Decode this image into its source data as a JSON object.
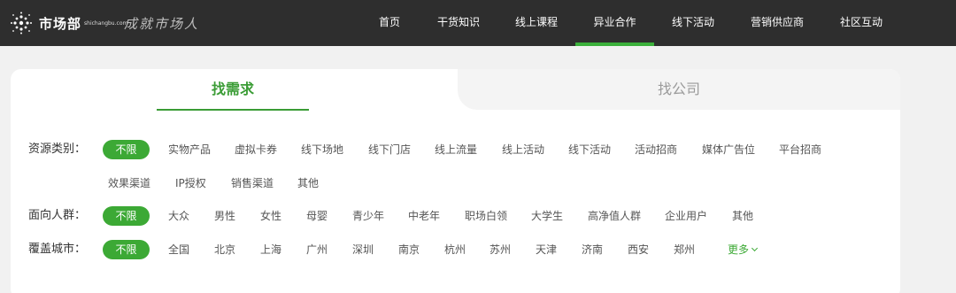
{
  "nav": {
    "logo_text": "市场部",
    "logo_sub": "shichangbu.com",
    "slogan": "成就市场人",
    "items": [
      "首页",
      "干货知识",
      "线上课程",
      "异业合作",
      "线下活动",
      "营销供应商",
      "社区互动"
    ],
    "active_index": 3
  },
  "tabs": {
    "left": "找需求",
    "right": "找公司"
  },
  "filters": {
    "resource": {
      "label": "资源类别：",
      "selected": "不限",
      "row1": [
        "实物产品",
        "虚拟卡券",
        "线下场地",
        "线下门店",
        "线上流量",
        "线上活动",
        "线下活动",
        "活动招商",
        "媒体广告位",
        "平台招商"
      ],
      "row2": [
        "效果渠道",
        "IP授权",
        "销售渠道",
        "其他"
      ]
    },
    "audience": {
      "label": "面向人群：",
      "selected": "不限",
      "options": [
        "大众",
        "男性",
        "女性",
        "母婴",
        "青少年",
        "中老年",
        "职场白领",
        "大学生",
        "高净值人群",
        "企业用户",
        "其他"
      ]
    },
    "city": {
      "label": "覆盖城市：",
      "selected": "不限",
      "options": [
        "全国",
        "北京",
        "上海",
        "广州",
        "深圳",
        "南京",
        "杭州",
        "苏州",
        "天津",
        "济南",
        "西安",
        "郑州"
      ],
      "more": "更多"
    }
  },
  "colors": {
    "brand_green": "#3ca935",
    "topbar": "#2e2e2e"
  }
}
